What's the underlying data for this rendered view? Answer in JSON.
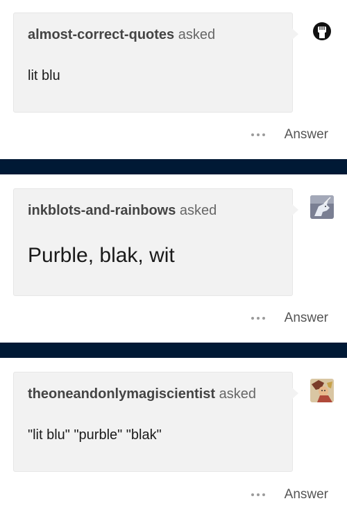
{
  "posts": [
    {
      "asker": "almost-correct-quotes",
      "asked_label": "asked",
      "question": "lit blu",
      "answer_label": "Answer",
      "avatar_icon": "fist-icon"
    },
    {
      "asker": "inkblots-and-rainbows",
      "asked_label": "asked",
      "question": "Purble, blak, wit",
      "answer_label": "Answer",
      "avatar_icon": "unicorn-icon"
    },
    {
      "asker": "theoneandonlymagiscientist",
      "asked_label": "asked",
      "question": "\"lit blu\" \"purble\" \"blak\"",
      "answer_label": "Answer",
      "avatar_icon": "character-art-icon"
    }
  ],
  "colors": {
    "divider": "#001935",
    "bubble": "#f2f2f2"
  }
}
